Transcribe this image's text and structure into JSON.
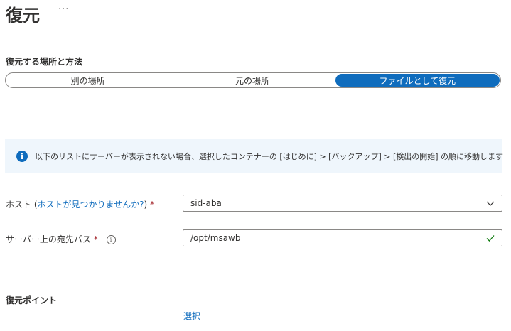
{
  "header": {
    "title": "復元",
    "more_label": "···"
  },
  "restore_method": {
    "label": "復元する場所と方法",
    "options": [
      "別の場所",
      "元の場所",
      "ファイルとして復元"
    ],
    "selected": "ファイルとして復元"
  },
  "info_banner": {
    "icon": "info-icon",
    "text": "以下のリストにサーバーが表示されない場合、選択したコンテナーの [はじめに] > [バックアップ] > [検出の開始] の順に移動します"
  },
  "host": {
    "label": "ホスト",
    "link_text": "ホストが見つかりませんか?",
    "required": "*",
    "value": "sid-aba",
    "icon": "chevron-down-icon"
  },
  "destination_path": {
    "label": "サーバー上の宛先パス",
    "required": "*",
    "info_icon": "info-circle-icon",
    "value": "/opt/msawb",
    "valid_icon": "checkmark-icon"
  },
  "restore_point": {
    "label": "復元ポイント",
    "select_link": "選択"
  },
  "colors": {
    "accent": "#0f6cbd",
    "banner_bg": "#eff6fc",
    "valid": "#107c10",
    "required": "#a4262c"
  }
}
